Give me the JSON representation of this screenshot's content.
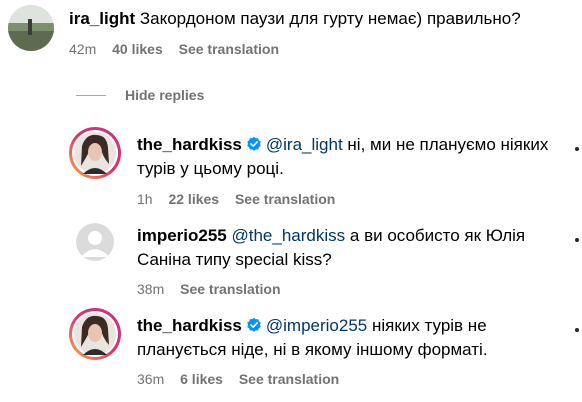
{
  "comments": [
    {
      "username": "ira_light",
      "text_line1": "Закордоном паузи для гурту немає) правильно?",
      "text_line2": "",
      "mention": "",
      "verified": false,
      "time": "42m",
      "likes": "40 likes",
      "translate": "See translation"
    },
    {
      "username": "the_hardkiss",
      "mention": "@ira_light",
      "text_line1": "ні, ми не плануємо ніяких",
      "text_line2": "турів у цьому році.",
      "verified": true,
      "time": "1h",
      "likes": "22 likes",
      "translate": "See translation"
    },
    {
      "username": "imperio255",
      "mention": "@the_hardkiss",
      "text_line1": "а ви особисто як Юлія",
      "text_line2": "Саніна типу special kiss?",
      "verified": false,
      "time": "38m",
      "likes": "",
      "translate": "See translation"
    },
    {
      "username": "the_hardkiss",
      "mention": "@imperio255",
      "text_line1": "ніяких турів не",
      "text_line2": "планується ніде, ні в якому іншому форматі.",
      "verified": true,
      "time": "36m",
      "likes": "6 likes",
      "translate": "See translation"
    }
  ],
  "hide_replies": "Hide replies",
  "colors": {
    "mention": "#00376b",
    "meta": "#737373",
    "verified": "#0095f6",
    "story_ring_start": "#fcaf45",
    "story_ring_end": "#c13584"
  }
}
